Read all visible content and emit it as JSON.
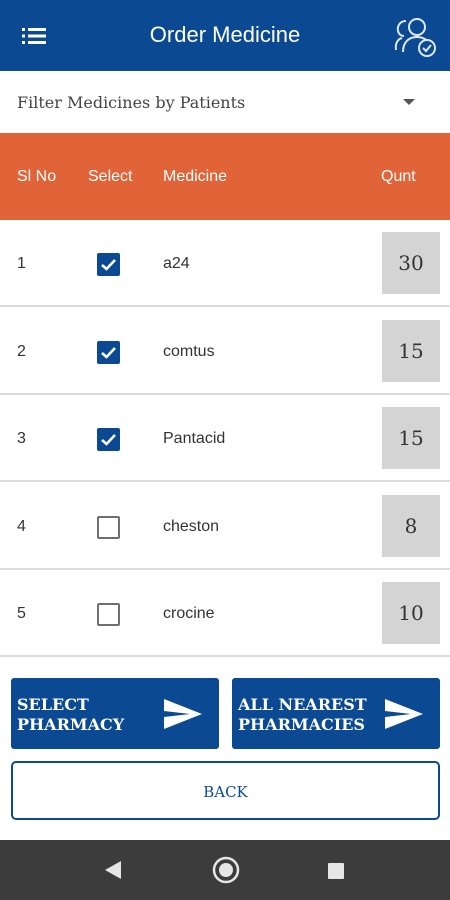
{
  "app_bar": {
    "title": "Order Medicine",
    "menu_icon": "hamburger-menu-icon",
    "patients_icon": "users-check-icon"
  },
  "filter": {
    "label": "Filter Medicines by Patients"
  },
  "table": {
    "headers": {
      "sl_no": "Sl No",
      "select": "Select",
      "medicine": "Medicine",
      "quantity": "Qunt"
    },
    "rows": [
      {
        "sl": "1",
        "selected": true,
        "medicine": "a24",
        "qty": "30"
      },
      {
        "sl": "2",
        "selected": true,
        "medicine": "comtus",
        "qty": "15"
      },
      {
        "sl": "3",
        "selected": true,
        "medicine": "Pantacid",
        "qty": "15"
      },
      {
        "sl": "4",
        "selected": false,
        "medicine": "cheston",
        "qty": "8"
      },
      {
        "sl": "5",
        "selected": false,
        "medicine": "crocine",
        "qty": "10"
      }
    ]
  },
  "actions": {
    "select_pharmacy": "SELECT PHARMACY",
    "all_nearest": "ALL NEAREST PHARMACIES",
    "back": "BACK"
  },
  "colors": {
    "primary": "#0b4a92",
    "header": "#e06437",
    "qty_bg": "#d4d4d4",
    "nav_bar": "#3c3c3c"
  }
}
